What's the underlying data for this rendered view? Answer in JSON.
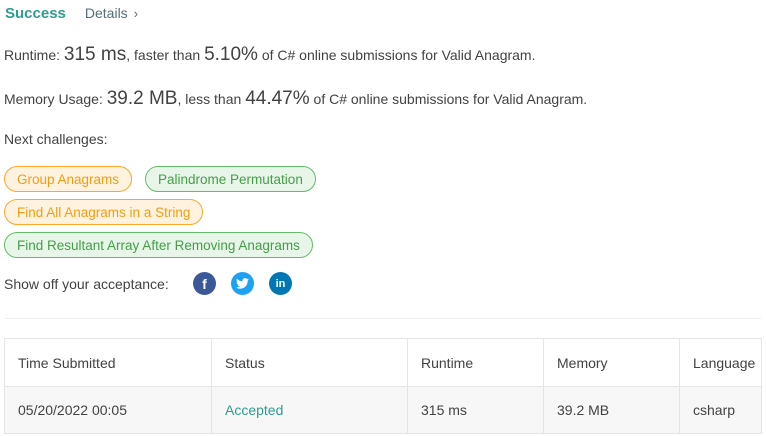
{
  "header": {
    "status": "Success",
    "details_label": "Details"
  },
  "runtime": {
    "label": "Runtime:",
    "value": "315 ms",
    "comparison": ", faster than",
    "percent": "5.10%",
    "suffix": "of C# online submissions for Valid Anagram."
  },
  "memory": {
    "label": "Memory Usage:",
    "value": "39.2 MB",
    "comparison": ", less than",
    "percent": "44.47%",
    "suffix": "of C# online submissions for Valid Anagram."
  },
  "next_challenges": {
    "label": "Next challenges:",
    "items": [
      {
        "label": "Group Anagrams",
        "difficulty_color": "orange"
      },
      {
        "label": "Palindrome Permutation",
        "difficulty_color": "green"
      },
      {
        "label": "Find All Anagrams in a String",
        "difficulty_color": "orange"
      },
      {
        "label": "Find Resultant Array After Removing Anagrams",
        "difficulty_color": "green"
      }
    ]
  },
  "share": {
    "label": "Show off your acceptance:",
    "icons": [
      "facebook-icon",
      "twitter-icon",
      "linkedin-icon"
    ]
  },
  "submissions": {
    "headers": [
      "Time Submitted",
      "Status",
      "Runtime",
      "Memory",
      "Language"
    ],
    "rows": [
      {
        "time": "05/20/2022 00:05",
        "status": "Accepted",
        "runtime": "315 ms",
        "memory": "39.2 MB",
        "language": "csharp"
      }
    ]
  },
  "colors": {
    "success": "#2d9d8f",
    "medium_challenge": "#ffa726",
    "easy_challenge": "#66bb6a",
    "facebook": "#3b5998",
    "twitter": "#1da1f2",
    "linkedin": "#0077b5"
  }
}
